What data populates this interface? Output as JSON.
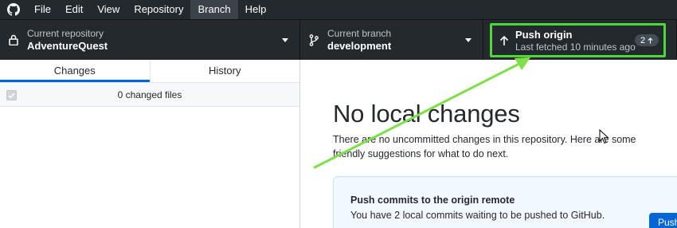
{
  "menu": {
    "items": [
      {
        "label": "File"
      },
      {
        "label": "Edit"
      },
      {
        "label": "View"
      },
      {
        "label": "Repository"
      },
      {
        "label": "Branch"
      },
      {
        "label": "Help"
      }
    ]
  },
  "toolbar": {
    "repository": {
      "label": "Current repository",
      "value": "AdventureQuest"
    },
    "branch": {
      "label": "Current branch",
      "value": "development"
    },
    "push": {
      "title": "Push origin",
      "subtitle": "Last fetched 10 minutes ago",
      "badge_count": "2"
    }
  },
  "sidebar": {
    "tabs": [
      {
        "label": "Changes"
      },
      {
        "label": "History"
      }
    ],
    "changed_files": "0 changed files"
  },
  "main": {
    "heading": "No local changes",
    "description": "There are no uncommitted changes in this repository. Here are some friendly suggestions for what to do next.",
    "card": {
      "title": "Push commits to the origin remote",
      "description": "You have 2 local commits waiting to be pushed to GitHub.",
      "button_label": "Push"
    }
  },
  "colors": {
    "toolbar_bg": "#24292e",
    "highlight": "#4fd638",
    "accent": "#0366d6",
    "card_bg": "#f1f8ff"
  },
  "icons": [
    "github-logo-icon",
    "lock-icon",
    "branch-icon",
    "arrow-up-icon",
    "caret-down-icon",
    "checkbox-icon",
    "mouse-cursor-icon"
  ]
}
